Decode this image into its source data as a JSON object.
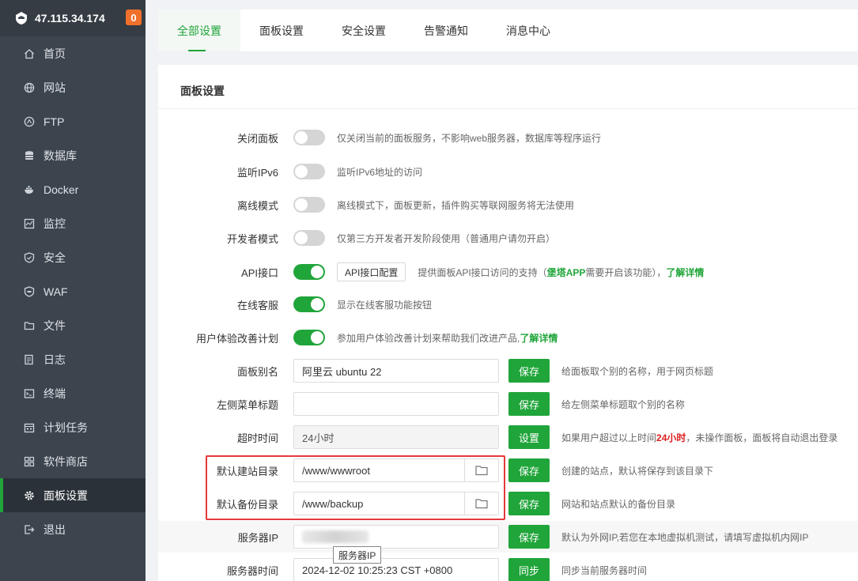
{
  "sidebar": {
    "ip": "47.115.34.174",
    "badge": "0",
    "items": [
      {
        "label": "首页",
        "icon": "home-icon"
      },
      {
        "label": "网站",
        "icon": "globe-icon"
      },
      {
        "label": "FTP",
        "icon": "ftp-icon"
      },
      {
        "label": "数据库",
        "icon": "database-icon"
      },
      {
        "label": "Docker",
        "icon": "docker-icon"
      },
      {
        "label": "监控",
        "icon": "monitor-icon"
      },
      {
        "label": "安全",
        "icon": "shield-icon"
      },
      {
        "label": "WAF",
        "icon": "waf-icon"
      },
      {
        "label": "文件",
        "icon": "folder-icon"
      },
      {
        "label": "日志",
        "icon": "log-icon"
      },
      {
        "label": "终端",
        "icon": "terminal-icon"
      },
      {
        "label": "计划任务",
        "icon": "calendar-icon"
      },
      {
        "label": "软件商店",
        "icon": "apps-icon"
      },
      {
        "label": "面板设置",
        "icon": "gear-icon"
      },
      {
        "label": "退出",
        "icon": "logout-icon"
      }
    ],
    "active_index": 13
  },
  "tabs": [
    "全部设置",
    "面板设置",
    "安全设置",
    "告警通知",
    "消息中心"
  ],
  "panel": {
    "title": "面板设置",
    "toggles": [
      {
        "label": "关闭面板",
        "on": false,
        "hint": "仅关闭当前的面板服务，不影响web服务器，数据库等程序运行"
      },
      {
        "label": "监听IPv6",
        "on": false,
        "hint": "监听IPv6地址的访问"
      },
      {
        "label": "离线模式",
        "on": false,
        "hint": "离线模式下，面板更新，插件购买等联网服务将无法使用"
      },
      {
        "label": "开发者模式",
        "on": false,
        "hint": "仅第三方开发者开发阶段使用（普通用户请勿开启）"
      }
    ],
    "api": {
      "label": "API接口",
      "on": true,
      "button": "API接口配置",
      "hint_pre": "提供面板API接口访问的支持（",
      "hint_green": "堡塔APP",
      "hint_mid": "需要开启该功能），",
      "hint_link": "了解详情"
    },
    "online_service": {
      "label": "在线客服",
      "on": true,
      "hint": "显示在线客服功能按钮"
    },
    "ux_plan": {
      "label": "用户体验改善计划",
      "on": true,
      "hint_pre": "参加用户体验改善计划来帮助我们改进产品,",
      "hint_link": "了解详情"
    },
    "alias": {
      "label": "面板别名",
      "value": "阿里云 ubuntu 22",
      "button": "保存",
      "hint": "给面板取个别的名称，用于网页标题"
    },
    "menu_title": {
      "label": "左侧菜单标题",
      "value": "",
      "button": "保存",
      "hint": "给左侧菜单标题取个别的名称"
    },
    "timeout": {
      "label": "超时时间",
      "value": "24小时",
      "button": "设置",
      "hint_pre": "如果用户超过以上时间",
      "hint_red": "24小时",
      "hint_post": "，未操作面板，面板将自动退出登录"
    },
    "site_dir": {
      "label": "默认建站目录",
      "value": "/www/wwwroot",
      "button": "保存",
      "hint": "创建的站点，默认将保存到该目录下"
    },
    "backup_dir": {
      "label": "默认备份目录",
      "value": "/www/backup",
      "button": "保存",
      "hint": "网站和站点默认的备份目录"
    },
    "server_ip": {
      "label": "服务器IP",
      "button": "保存",
      "hint": "默认为外网IP,若您在本地虚拟机测试，请填写虚拟机内网IP",
      "tooltip": "服务器IP"
    },
    "server_time": {
      "label": "服务器时间",
      "value": "2024-12-02 10:25:23 CST +0800",
      "button": "同步",
      "hint": "同步当前服务器时间"
    }
  },
  "colors": {
    "accent": "#20a53a",
    "sidebar_bg": "#3c444d",
    "badge": "#f0702b",
    "highlight": "#e5393b"
  }
}
